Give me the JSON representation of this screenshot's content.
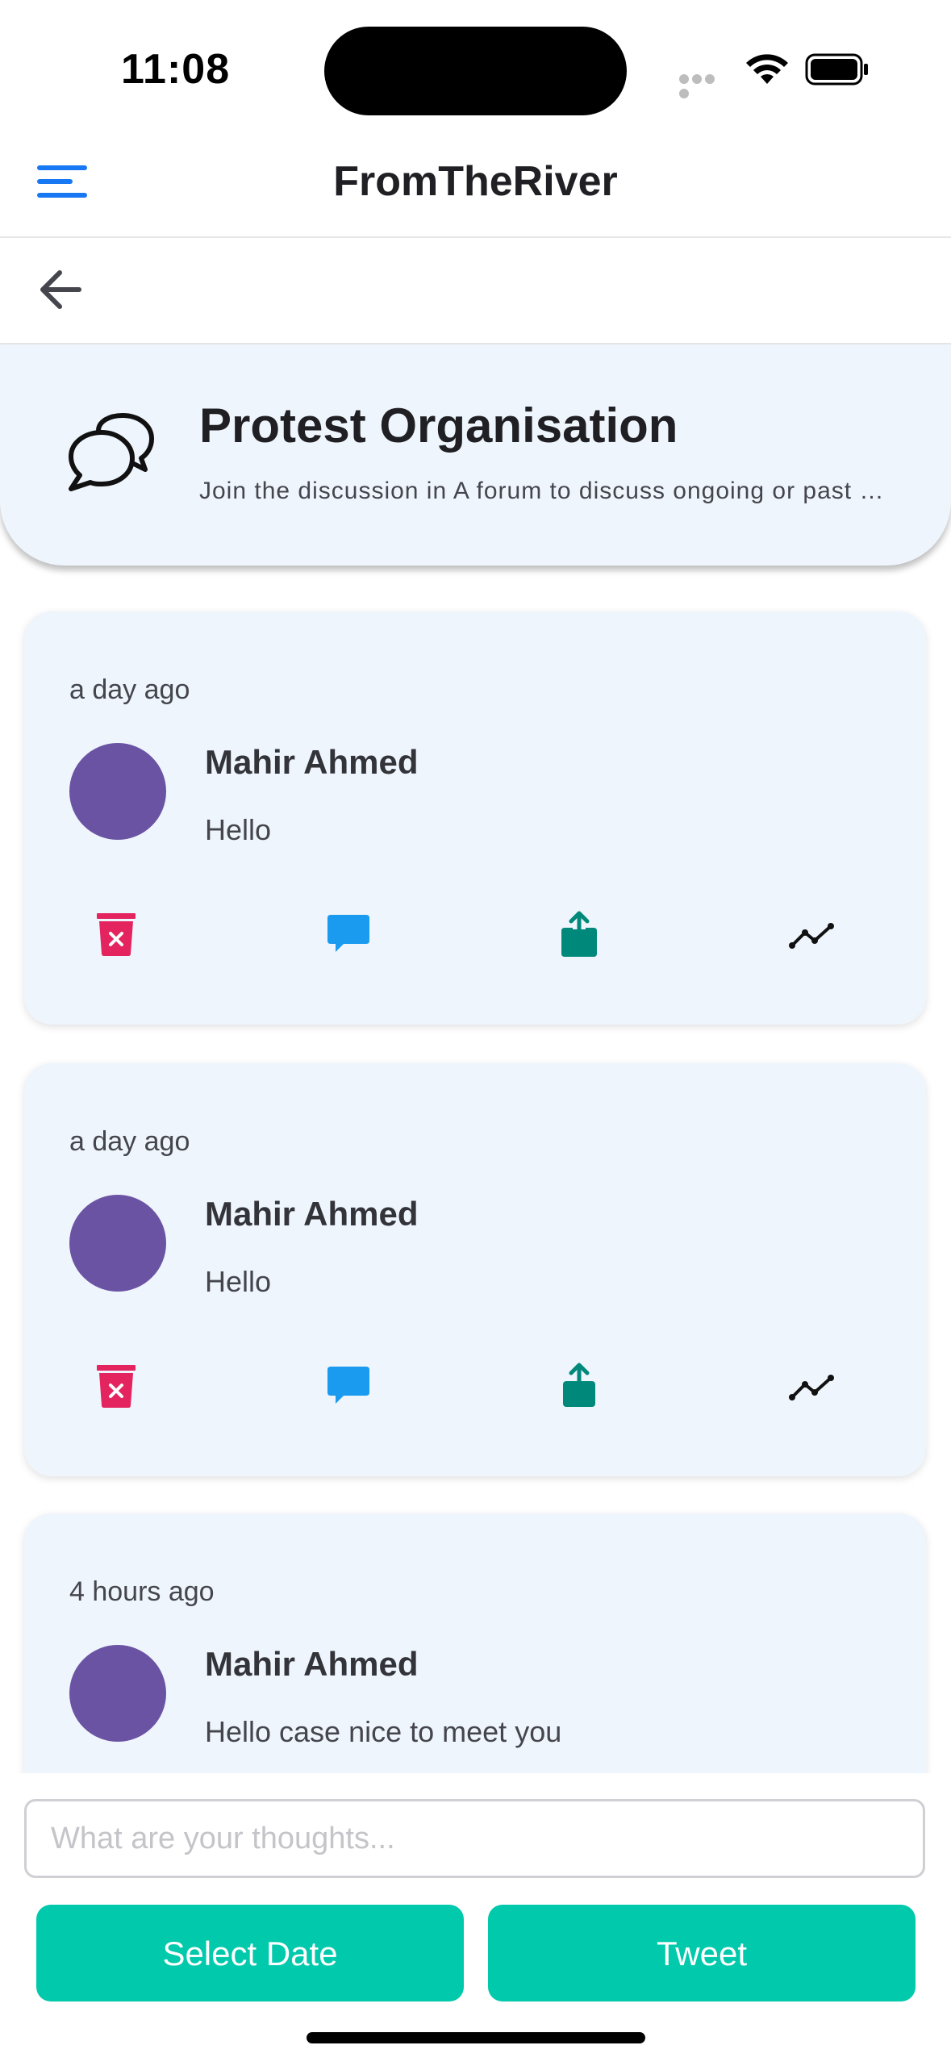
{
  "status_bar": {
    "time": "11:08"
  },
  "app_bar": {
    "title": "FromTheRiver"
  },
  "forum": {
    "title": "Protest Organisation",
    "description": "Join the discussion in A forum to discuss ongoing or past protests and share experiences"
  },
  "posts": [
    {
      "timestamp": "a day ago",
      "author": "Mahir Ahmed",
      "message": "Hello"
    },
    {
      "timestamp": "a day ago",
      "author": "Mahir Ahmed",
      "message": "Hello"
    },
    {
      "timestamp": "4 hours ago",
      "author": "Mahir Ahmed",
      "message": "Hello case nice to meet you"
    }
  ],
  "composer": {
    "placeholder": "What are your thoughts...",
    "select_date_label": "Select Date",
    "tweet_label": "Tweet"
  },
  "colors": {
    "accent": "#00c9ac",
    "menu": "#1877f2",
    "avatar": "#6b53a4",
    "delete": "#e3245f",
    "comment": "#1a9bf0",
    "share": "#00897b",
    "card_bg": "#eef5fc"
  },
  "icons": [
    "menu-icon",
    "back-arrow-icon",
    "chat-bubbles-icon",
    "delete-icon",
    "comment-icon",
    "share-icon",
    "stats-icon"
  ]
}
